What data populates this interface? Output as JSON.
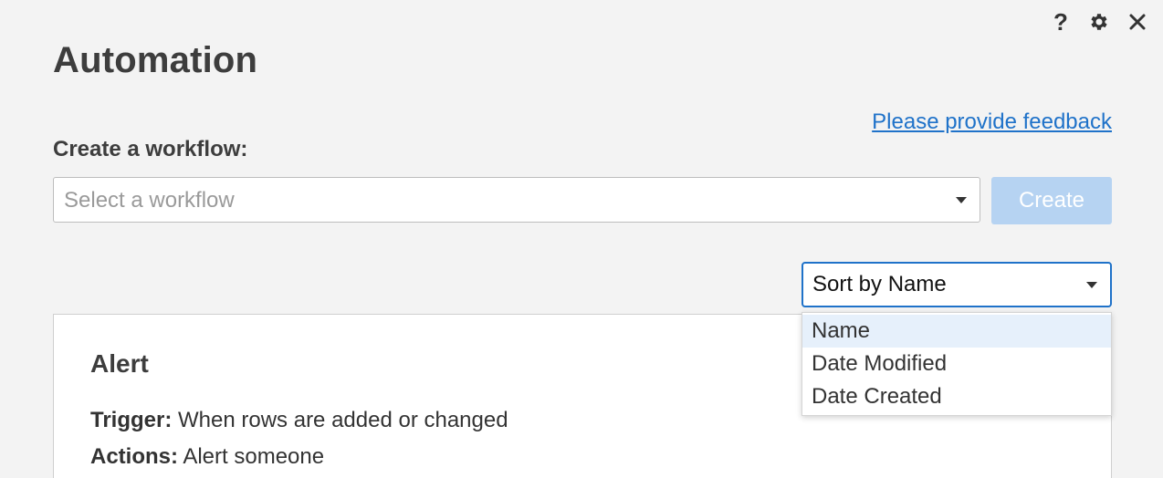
{
  "window": {
    "help_icon": "question-mark",
    "settings_icon": "gear",
    "close_icon": "close-x"
  },
  "header": {
    "title": "Automation",
    "feedback_link": "Please provide feedback"
  },
  "create": {
    "label": "Create a workflow:",
    "select_placeholder": "Select a workflow",
    "button_label": "Create",
    "button_disabled": true
  },
  "sort": {
    "selected_label": "Sort by Name",
    "options": [
      "Name",
      "Date Modified",
      "Date Created"
    ],
    "highlighted_option": "Name",
    "open": true
  },
  "workflows": [
    {
      "title": "Alert",
      "trigger_label": "Trigger:",
      "trigger_value": "When rows are added or changed",
      "actions_label": "Actions:",
      "actions_value": "Alert someone"
    }
  ],
  "colors": {
    "background": "#f3f3f3",
    "link": "#1f72c9",
    "focus_border": "#1f72c9",
    "create_button_disabled": "#b6d3f2",
    "option_highlight": "#e6f0fb"
  }
}
